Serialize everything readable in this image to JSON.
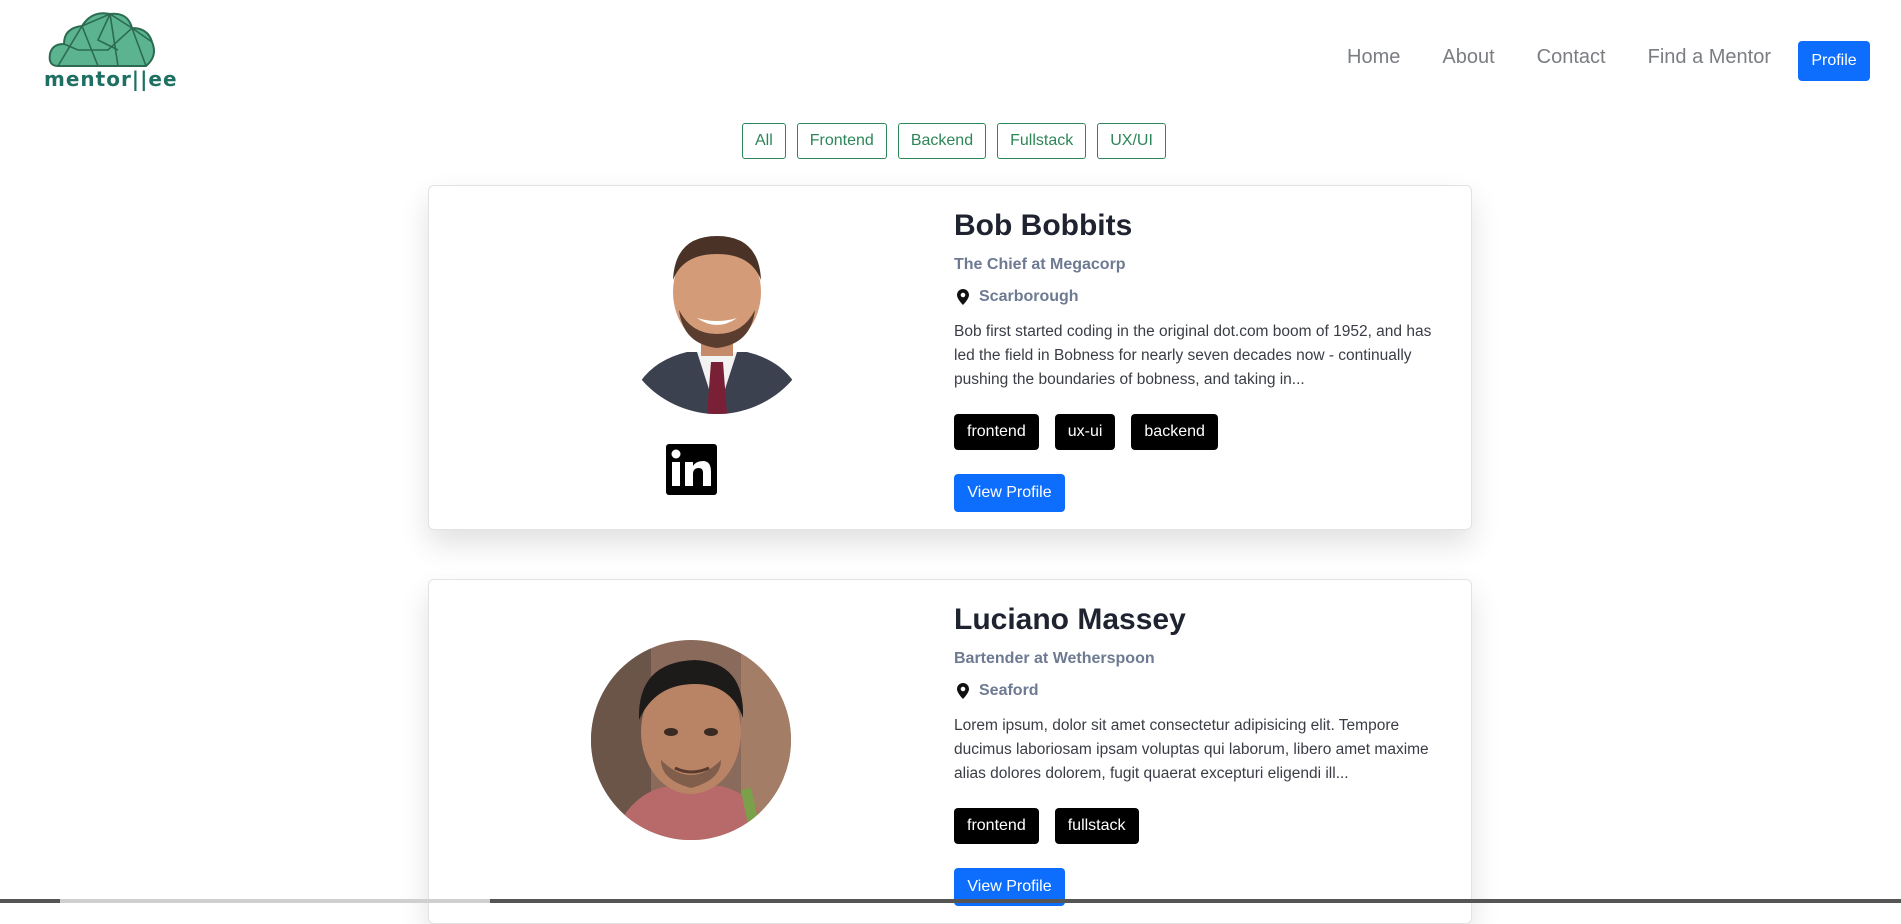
{
  "brand": {
    "name": "mentor||ee",
    "color": "#1f6f63"
  },
  "nav": {
    "links": [
      "Home",
      "About",
      "Contact",
      "Find a Mentor"
    ],
    "profile_label": "Profile"
  },
  "filters": [
    "All",
    "Frontend",
    "Backend",
    "Fullstack",
    "UX/UI"
  ],
  "colors": {
    "primary": "#0d6efd",
    "filter_green": "#2d8657",
    "tag_bg": "#000000"
  },
  "mentors": [
    {
      "name": "Bob Bobbits",
      "role": "The Chief at Megacorp",
      "location": "Scarborough",
      "bio": "Bob first started coding in the original dot.com boom of 1952, and has led the field in Bobness for nearly seven decades now - continually pushing the boundaries of bobness, and taking in...",
      "tags": [
        "frontend",
        "ux-ui",
        "backend"
      ],
      "has_linkedin": true,
      "view_label": "View Profile"
    },
    {
      "name": "Luciano Massey",
      "role": "Bartender at Wetherspoon",
      "location": "Seaford",
      "bio": "Lorem ipsum, dolor sit amet consectetur adipisicing elit. Tempore ducimus laboriosam ipsam voluptas qui laborum, libero amet maxime alias dolores dolorem, fugit quaerat excepturi eligendi ill...",
      "tags": [
        "frontend",
        "fullstack"
      ],
      "has_linkedin": false,
      "view_label": "View Profile"
    }
  ]
}
